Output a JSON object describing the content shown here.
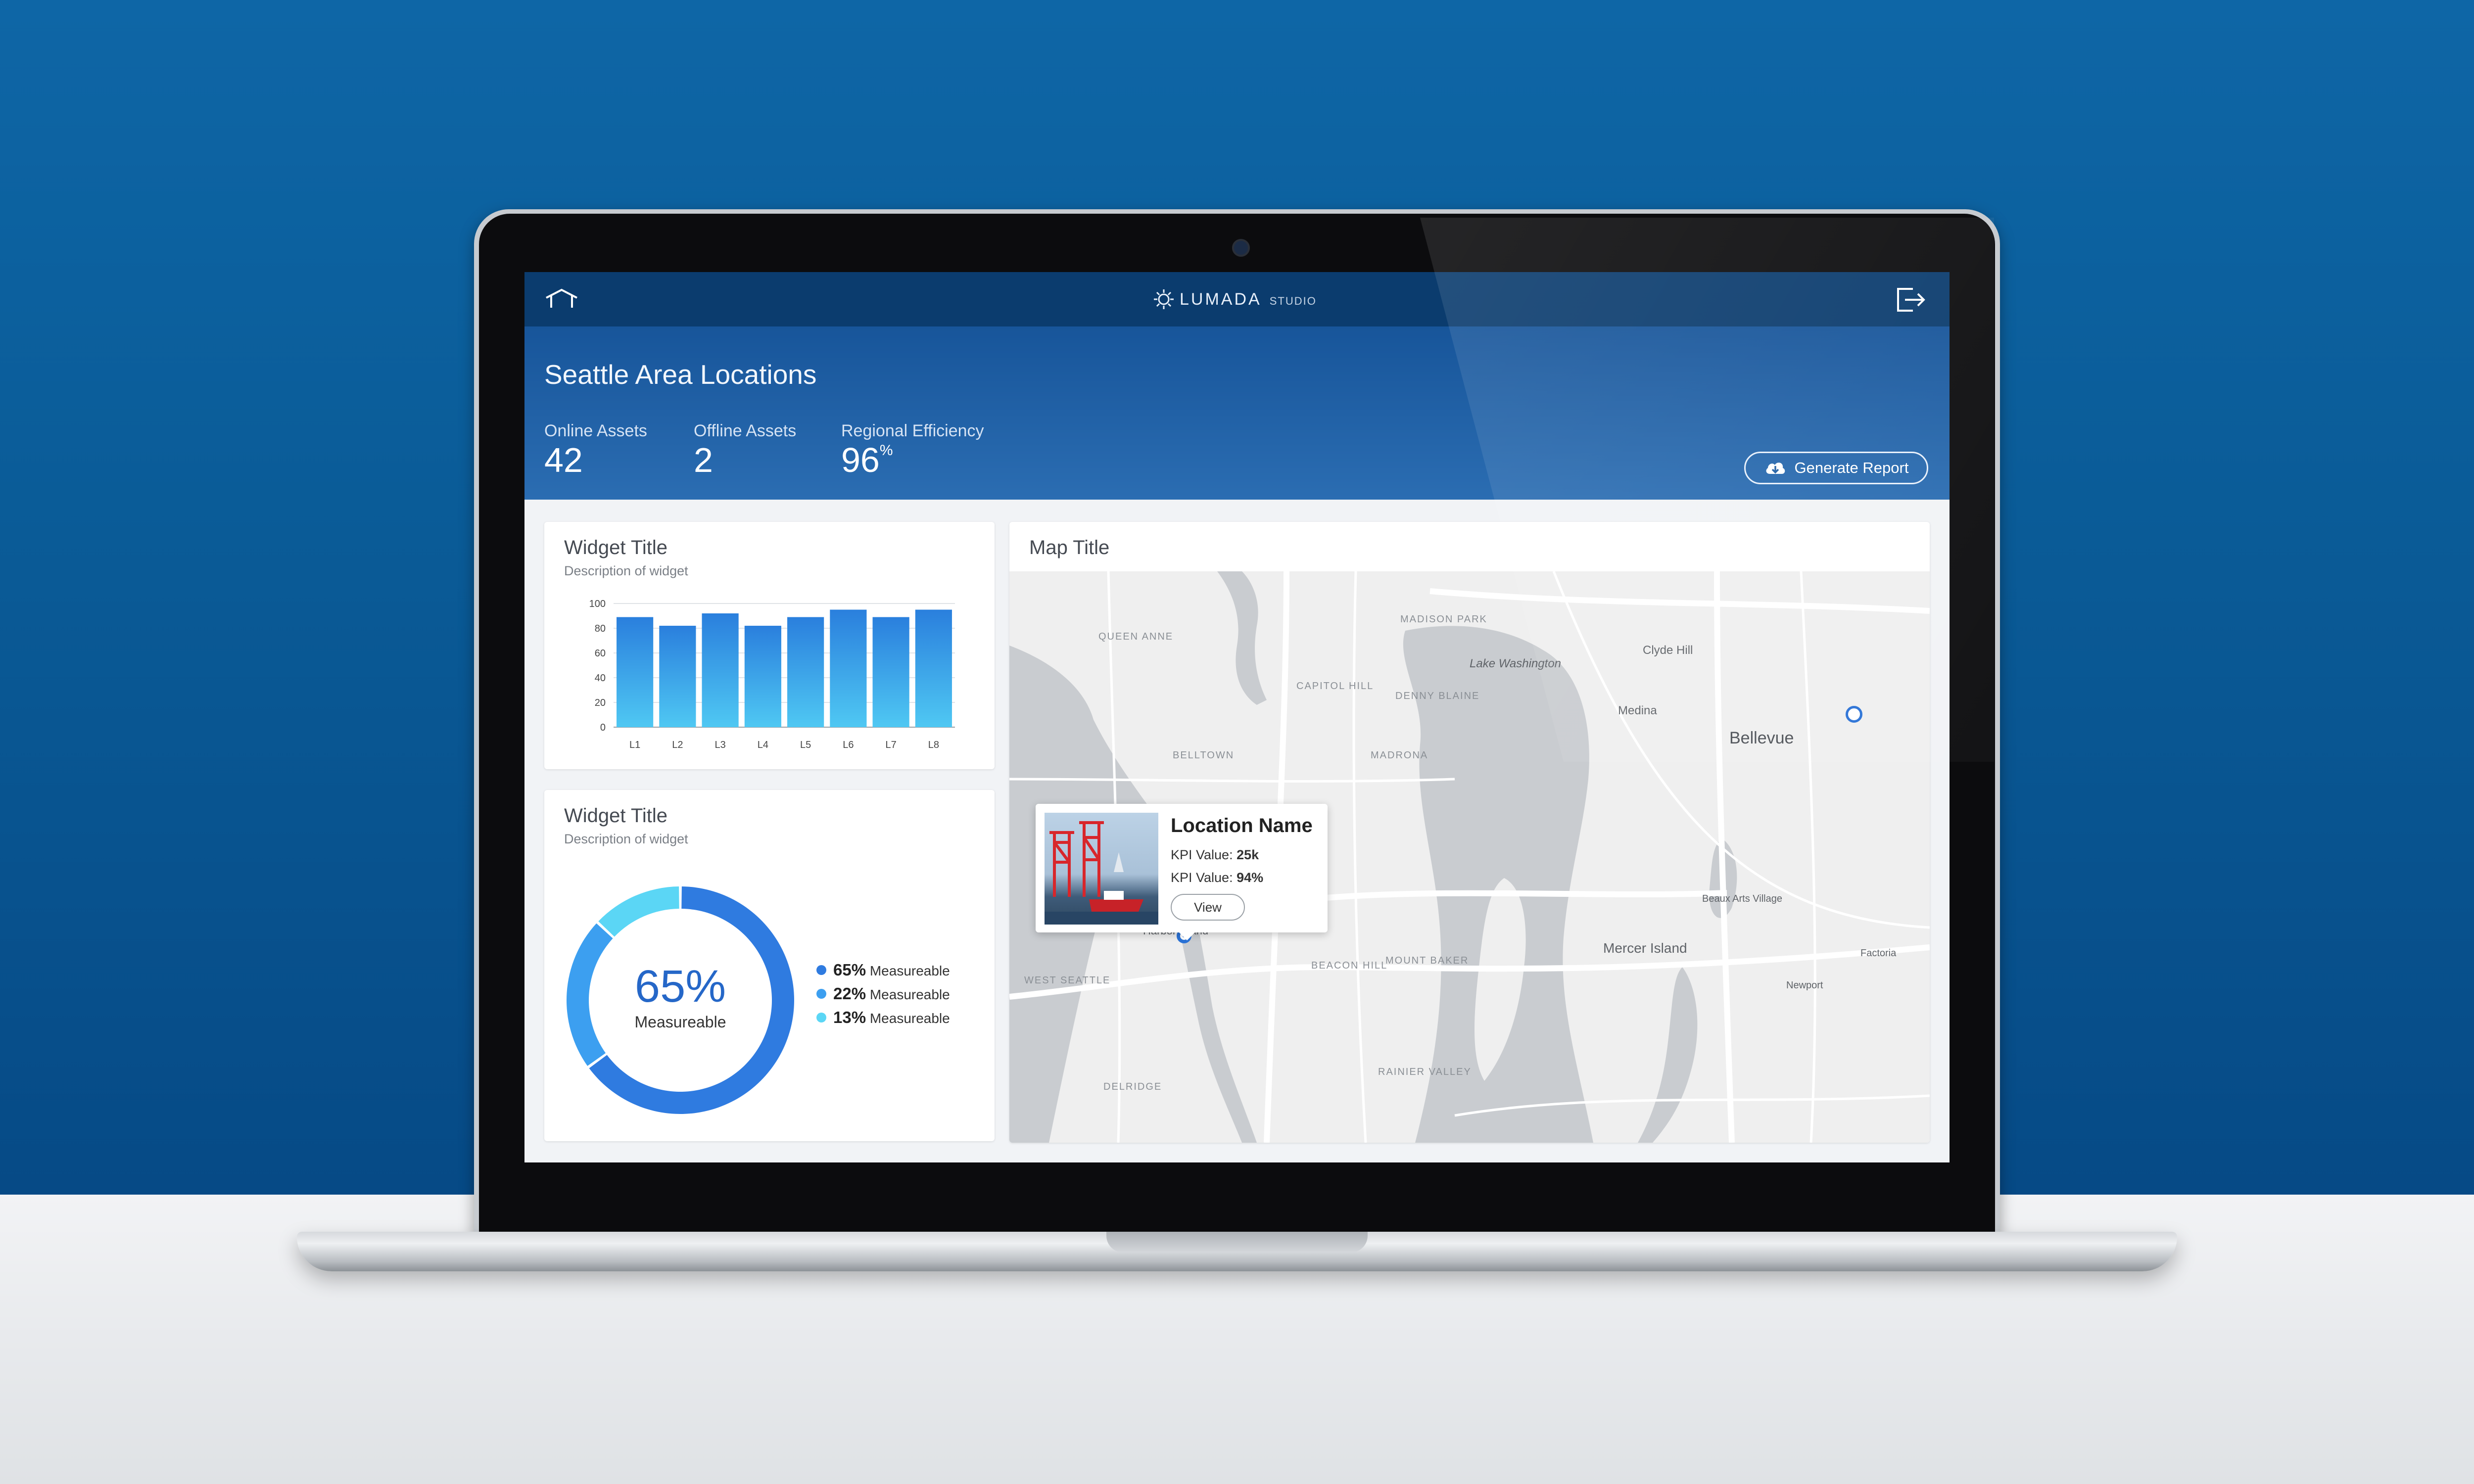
{
  "app": {
    "brand": "LUMADA",
    "brand_sub": "STUDIO",
    "home_icon": "home-icon",
    "logout_icon": "logout-icon"
  },
  "header": {
    "title": "Seattle Area Locations",
    "kpis": [
      {
        "label": "Online Assets",
        "value": "42",
        "unit": ""
      },
      {
        "label": "Offline Assets",
        "value": "2",
        "unit": ""
      },
      {
        "label": "Regional Efficiency",
        "value": "96",
        "unit": "%"
      }
    ],
    "report_button": "Generate Report",
    "report_icon": "cloud-download-icon"
  },
  "bar_widget": {
    "title": "Widget Title",
    "description": "Description of widget"
  },
  "donut_widget": {
    "title": "Widget Title",
    "description": "Description of widget",
    "center_value": "65%",
    "center_label": "Measureable",
    "legend": [
      {
        "value": "65%",
        "label": "Measureable",
        "color": "#2f7be0"
      },
      {
        "value": "22%",
        "label": "Measureable",
        "color": "#3c9ff0"
      },
      {
        "value": "13%",
        "label": "Measureable",
        "color": "#5bd6f5"
      }
    ]
  },
  "map": {
    "title": "Map Title",
    "popup": {
      "name": "Location Name",
      "kpi1_label": "KPI Value:",
      "kpi1_value": "25k",
      "kpi2_label": "KPI Value:",
      "kpi2_value": "94%",
      "view_button": "View"
    },
    "labels": {
      "queen_anne": "QUEEN ANNE",
      "capitol_hill": "CAPITOL HILL",
      "madison_park": "MADISON PARK",
      "denny_blaine": "DENNY BLAINE",
      "madrona": "MADRONA",
      "belltown": "BELLTOWN",
      "lake_washington": "Lake Washington",
      "clyde_hill": "Clyde Hill",
      "medina": "Medina",
      "bellevue": "Bellevue",
      "mercer_island": "Mercer Island",
      "harbor_island": "Harbor Island",
      "west_seattle": "WEST SEATTLE",
      "beacon_hill": "BEACON HILL",
      "mount_baker": "MOUNT BAKER",
      "rainier_valley": "RAINIER VALLEY",
      "delridge": "DELRIDGE",
      "factoria": "Factoria",
      "newport": "Newport",
      "beaux_arts": "Beaux Arts Village"
    }
  },
  "chart_data": [
    {
      "type": "bar",
      "title": "Widget Title",
      "categories": [
        "L1",
        "L2",
        "L3",
        "L4",
        "L5",
        "L6",
        "L7",
        "L8"
      ],
      "values": [
        89,
        82,
        92,
        82,
        89,
        95,
        89,
        95
      ],
      "yticks": [
        "0",
        "20",
        "40",
        "60",
        "80",
        "100"
      ],
      "ylim": [
        0,
        100
      ],
      "grid": true,
      "color": "#2a86e0"
    },
    {
      "type": "pie",
      "title": "Widget Title",
      "categories": [
        "Measureable",
        "Measureable",
        "Measureable"
      ],
      "values": [
        65,
        22,
        13
      ],
      "colors": [
        "#2f7be0",
        "#3c9ff0",
        "#5bd6f5"
      ]
    }
  ]
}
